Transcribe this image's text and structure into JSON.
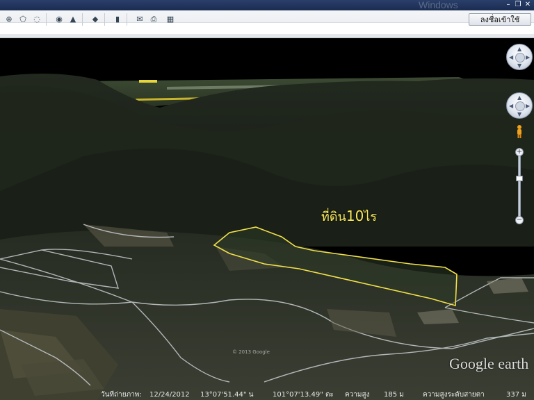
{
  "window": {
    "title_logo_text": "Windows",
    "minimize_glyph": "–",
    "restore_glyph": "❐",
    "close_glyph": "✕"
  },
  "toolbar": {
    "buttons": [
      {
        "icon": "add-placemark-icon",
        "glyph": "⊕"
      },
      {
        "icon": "add-polygon-icon",
        "glyph": "⬠"
      },
      {
        "icon": "add-path-icon",
        "glyph": "◌"
      },
      {
        "icon": "globe-icon",
        "glyph": "◉"
      },
      {
        "icon": "historical-imagery-icon",
        "glyph": "▲"
      },
      {
        "icon": "ruler-icon",
        "glyph": "◆"
      },
      {
        "icon": "sky-toggle-icon",
        "glyph": "▮"
      },
      {
        "icon": "email-icon",
        "glyph": "✉"
      },
      {
        "icon": "print-icon",
        "glyph": "⎙"
      },
      {
        "icon": "image-export-icon",
        "glyph": "▦"
      }
    ],
    "signin_label": "ลงชื่อเข้าใช้"
  },
  "map": {
    "parcel_label_prefix": "ที่ดิน",
    "parcel_label_number": "10",
    "parcel_label_suffix": "ไร",
    "outline_color": "#f2e14a",
    "watermark": "Google earth",
    "copyright": "© 2013 Google"
  },
  "navigation": {
    "look_icon": "look-around-icon",
    "move_icon": "pan-icon",
    "pegman_icon": "street-view-pegman-icon",
    "zoom_in": "+",
    "zoom_out": "−"
  },
  "status": {
    "imagery_date_label": "วันที่ถ่ายภาพ:",
    "imagery_date": "12/24/2012",
    "latitude": "13°07'51.44\" น",
    "longitude": "101°07'13.49\" ตะ",
    "elevation_label": "ความสูง",
    "elevation_value": "185 ม",
    "eye_alt_label": "ความสูงระดับสายตา",
    "eye_alt_value": "337 ม"
  },
  "colors": {
    "forest_dark": "#1c2218",
    "sky": "#000000",
    "road": "#c9cdd0",
    "field": "#6f6f5a"
  }
}
